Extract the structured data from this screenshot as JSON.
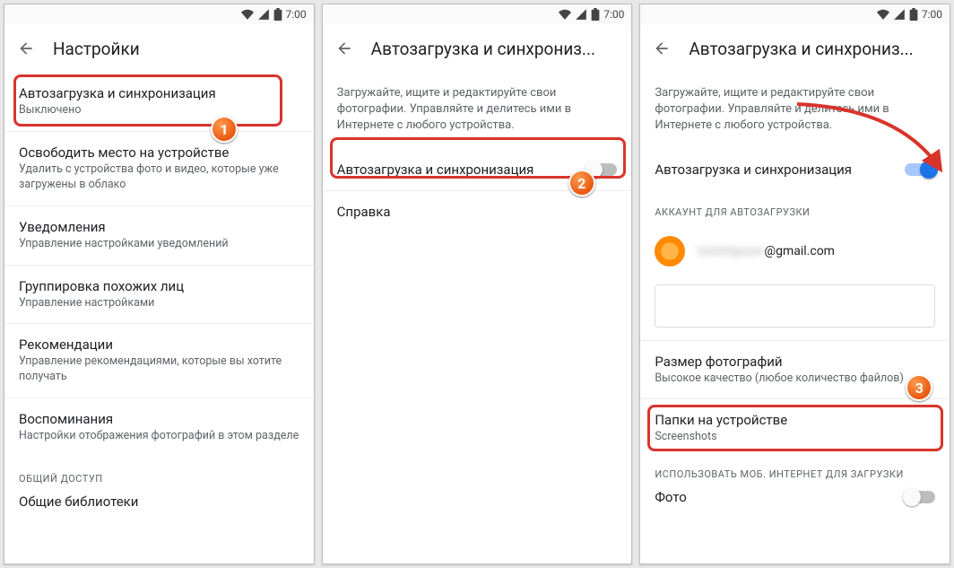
{
  "status": {
    "time": "7:00"
  },
  "screen1": {
    "title": "Настройки",
    "items": [
      {
        "title": "Автозагрузка и синхронизация",
        "subtitle": "Выключено"
      },
      {
        "title": "Освободить место на устройстве",
        "subtitle": "Удалить с устройства фото и видео, которые уже загружены в облако"
      },
      {
        "title": "Уведомления",
        "subtitle": "Управление настройками уведомлений"
      },
      {
        "title": "Группировка похожих лиц",
        "subtitle": "Управление настройками"
      },
      {
        "title": "Рекомендации",
        "subtitle": "Управление рекомендациями, которые вы хотите получать"
      },
      {
        "title": "Воспоминания",
        "subtitle": "Настройки отображения фотографий в этом разделе"
      }
    ],
    "section_share": "ОБЩИЙ ДОСТУП",
    "shared_libs": "Общие библиотеки"
  },
  "screen2": {
    "title": "Автозагрузка и синхрониз...",
    "desc": "Загружайте, ищите и редактируйте свои фотографии. Управляйте и делитесь ими в Интернете с любого устройства.",
    "toggle_label": "Автозагрузка и синхронизация",
    "help": "Справка"
  },
  "screen3": {
    "title": "Автозагрузка и синхрониз...",
    "desc": "Загружайте, ищите и редактируйте свои фотографии. Управляйте и делитесь ими в Интернете с любого устройства.",
    "toggle_label": "Автозагрузка и синхронизация",
    "account_section": "АККАУНТ ДЛЯ АВТОЗАГРУЗКИ",
    "email_tail": "@gmail.com",
    "size_title": "Размер фотографий",
    "size_sub": "Высокое качество (любое количество файлов)",
    "folders_title": "Папки на устройстве",
    "folders_sub": "Screenshots",
    "mobile_section": "ИСПОЛЬЗОВАТЬ МОБ. ИНТЕРНЕТ ДЛЯ ЗАГРУЗКИ",
    "photo_label": "Фото"
  },
  "callouts": {
    "n1": "1",
    "n2": "2",
    "n3": "3"
  }
}
